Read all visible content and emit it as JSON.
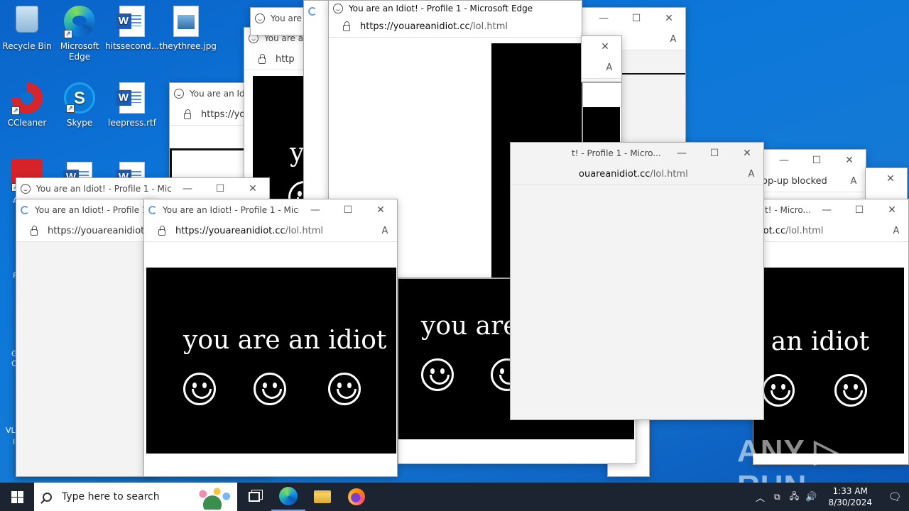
{
  "desktop": {
    "icons": [
      {
        "label": "Recycle Bin"
      },
      {
        "label": "Microsoft Edge"
      },
      {
        "label": "hitssecond..."
      },
      {
        "label": "theythree.jpg"
      },
      {
        "label": "CCleaner"
      },
      {
        "label": "Skype"
      },
      {
        "label": "leepress.rtf"
      }
    ],
    "partial_labels": [
      "A",
      "A",
      "F",
      "G",
      "C",
      "VL",
      "I"
    ]
  },
  "windows": {
    "title_full": "You are an Idiot! - Profile 1 - Microsoft Edge",
    "title_trunc": "You are an Idiot! - Profile 1 - Micro...",
    "title_trunc2": "You are an Idiot! - Profile 1 - M",
    "title_short": "You are an Idiot",
    "title_short2": "You are a",
    "title_partial": "t! - Profile 1 - Micro...",
    "title_partial2": "t! - Micro...",
    "url_host": "https://youareanidiot.cc",
    "url_path": "/lol.html",
    "url_trunc": "https://youareanidiot.",
    "url_short": "https://yo",
    "url_short2": "http",
    "url_partial": "ouareanidiot.cc",
    "url_partial2": "iot.cc",
    "popup_blocked": "op-up blocked",
    "content_text": "you are an idiot",
    "content_text_partial": "you are",
    "content_text_partial2": "e an idiot",
    "content_text_tiny": "yo"
  },
  "taskbar": {
    "search_placeholder": "Type here to search",
    "time": "1:33 AM",
    "date": "8/30/2024"
  },
  "watermark": "ANY ▷ RUN",
  "icons": {
    "minimize": "minimize-icon",
    "maximize": "maximize-icon",
    "close": "close-icon",
    "lock": "lock-icon",
    "read-aloud": "read-aloud-icon"
  }
}
